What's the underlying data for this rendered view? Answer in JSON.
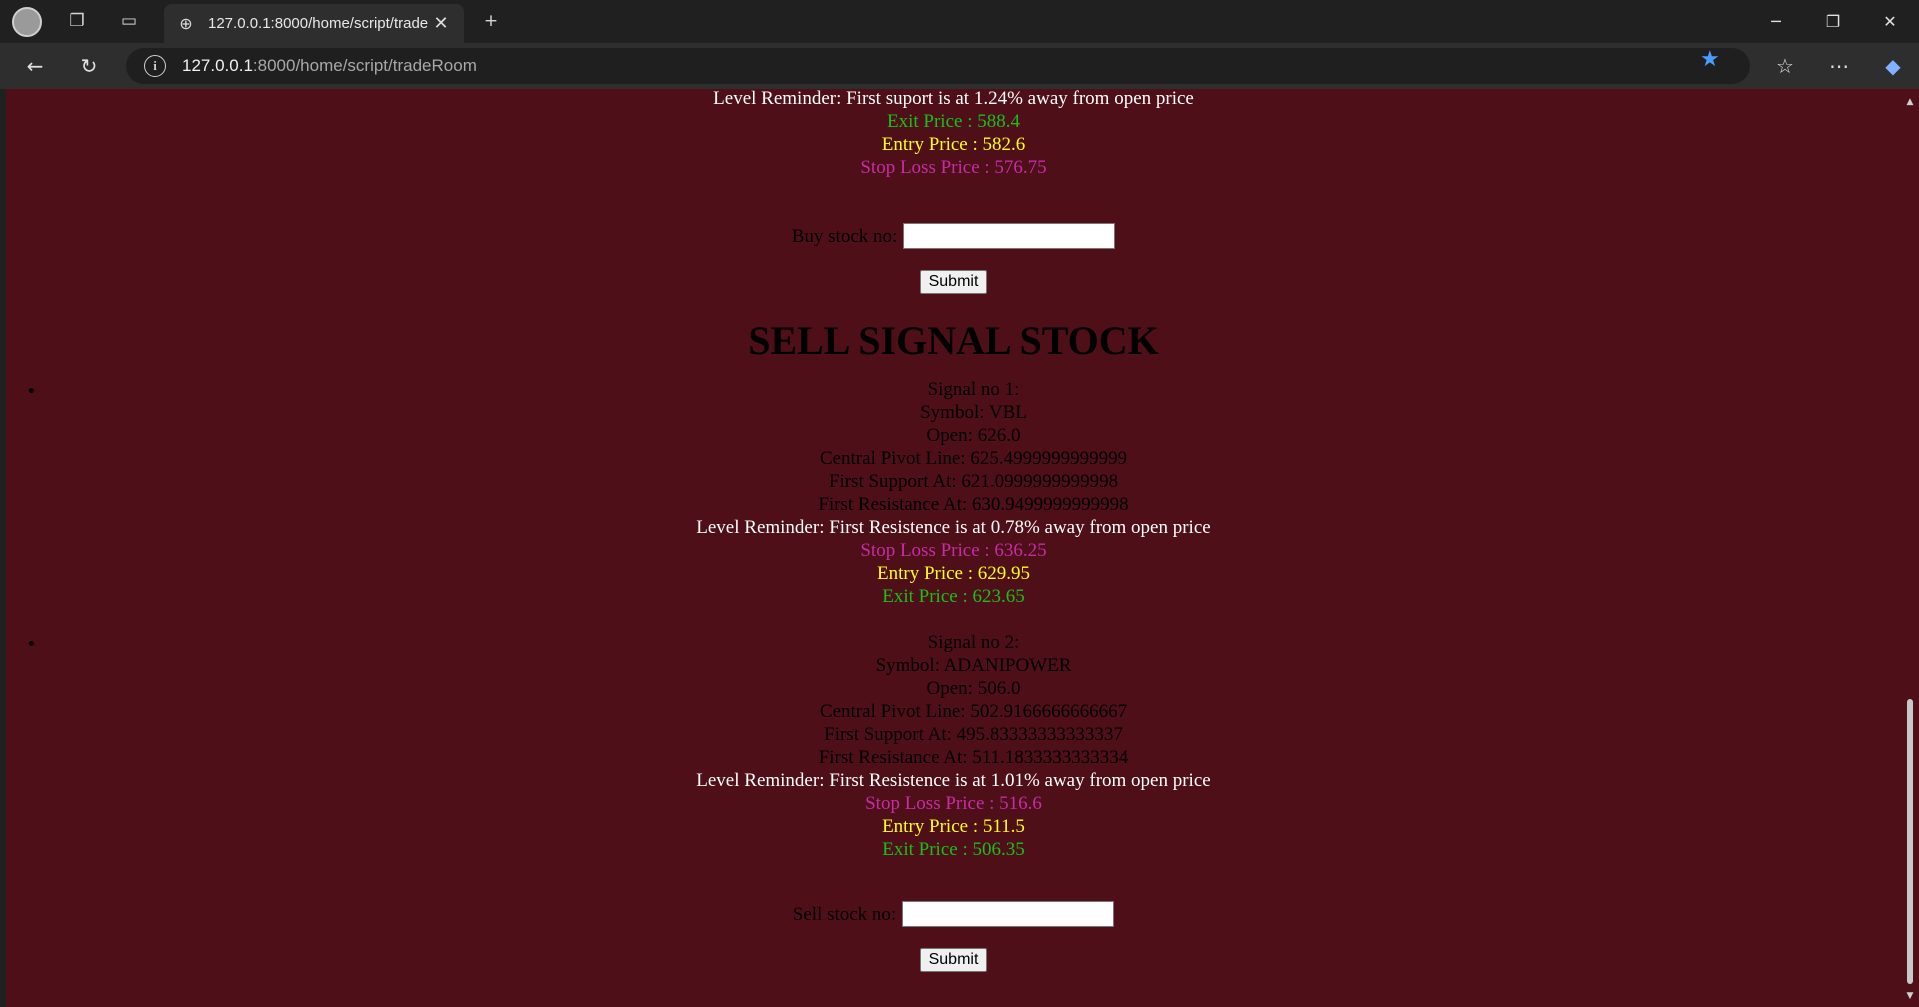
{
  "browser": {
    "tab_title": "127.0.0.1:8000/home/script/trade",
    "url_host": "127.0.0.1",
    "url_path": ":8000/home/script/tradeRoom"
  },
  "buy_tail": {
    "level_reminder": "Level Reminder: First suport is at 1.24% away from open price",
    "exit": "Exit Price : 588.4",
    "entry": "Entry Price : 582.6",
    "stop": "Stop Loss Price : 576.75",
    "input_label": "Buy stock no:",
    "submit": "Submit"
  },
  "sell": {
    "heading": "SELL SIGNAL STOCK",
    "signals": [
      {
        "signal": "Signal no 1:",
        "symbol": "Symbol: VBL",
        "open": "Open: 626.0",
        "cpl": "Central Pivot Line: 625.4999999999999",
        "support": "First Support At: 621.0999999999998",
        "resistance": "First Resistance At: 630.9499999999998",
        "level_reminder": "Level Reminder: First Resistence is at 0.78% away from open price",
        "stop": "Stop Loss Price : 636.25",
        "entry": "Entry Price : 629.95",
        "exit": "Exit Price : 623.65"
      },
      {
        "signal": "Signal no 2:",
        "symbol": "Symbol: ADANIPOWER",
        "open": "Open: 506.0",
        "cpl": "Central Pivot Line: 502.9166666666667",
        "support": "First Support At: 495.83333333333337",
        "resistance": "First Resistance At: 511.1833333333334",
        "level_reminder": "Level Reminder: First Resistence is at 1.01% away from open price",
        "stop": "Stop Loss Price : 516.6",
        "entry": "Entry Price : 511.5",
        "exit": "Exit Price : 506.35"
      }
    ],
    "input_label": "Sell stock no:",
    "submit": "Submit"
  },
  "colors": {
    "page_bg": "#4e0f19",
    "exit": "#18c018",
    "entry": "#ffff1a",
    "stop": "#c72ca6"
  }
}
